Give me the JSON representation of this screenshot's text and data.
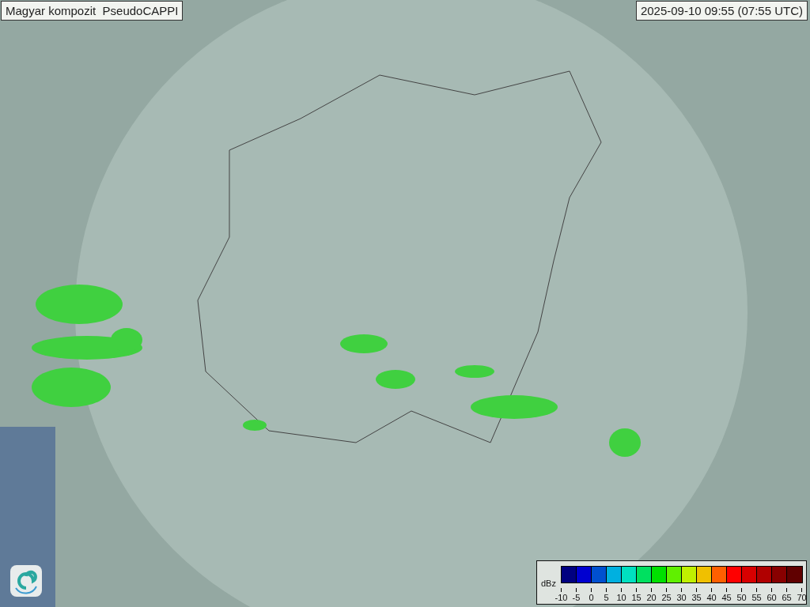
{
  "title": "Magyar kompozit  PseudoCAPPI",
  "timestamp": "2025-09-10 09:55 (07:55 UTC)",
  "legend": {
    "unit": "dBz",
    "bins": [
      {
        "color": "#000080"
      },
      {
        "color": "#0000d0"
      },
      {
        "color": "#0050d0"
      },
      {
        "color": "#00b0e0"
      },
      {
        "color": "#00e0c0"
      },
      {
        "color": "#00e060"
      },
      {
        "color": "#00e000"
      },
      {
        "color": "#60f000"
      },
      {
        "color": "#c0f000"
      },
      {
        "color": "#f0c000"
      },
      {
        "color": "#ff6000"
      },
      {
        "color": "#ff0000"
      },
      {
        "color": "#d80000"
      },
      {
        "color": "#b00000"
      },
      {
        "color": "#880000"
      },
      {
        "color": "#600000"
      }
    ],
    "ticks": [
      "-10",
      "-5",
      "0",
      "5",
      "10",
      "15",
      "20",
      "25",
      "30",
      "35",
      "40",
      "45",
      "50",
      "55",
      "60",
      "65",
      "70"
    ]
  }
}
